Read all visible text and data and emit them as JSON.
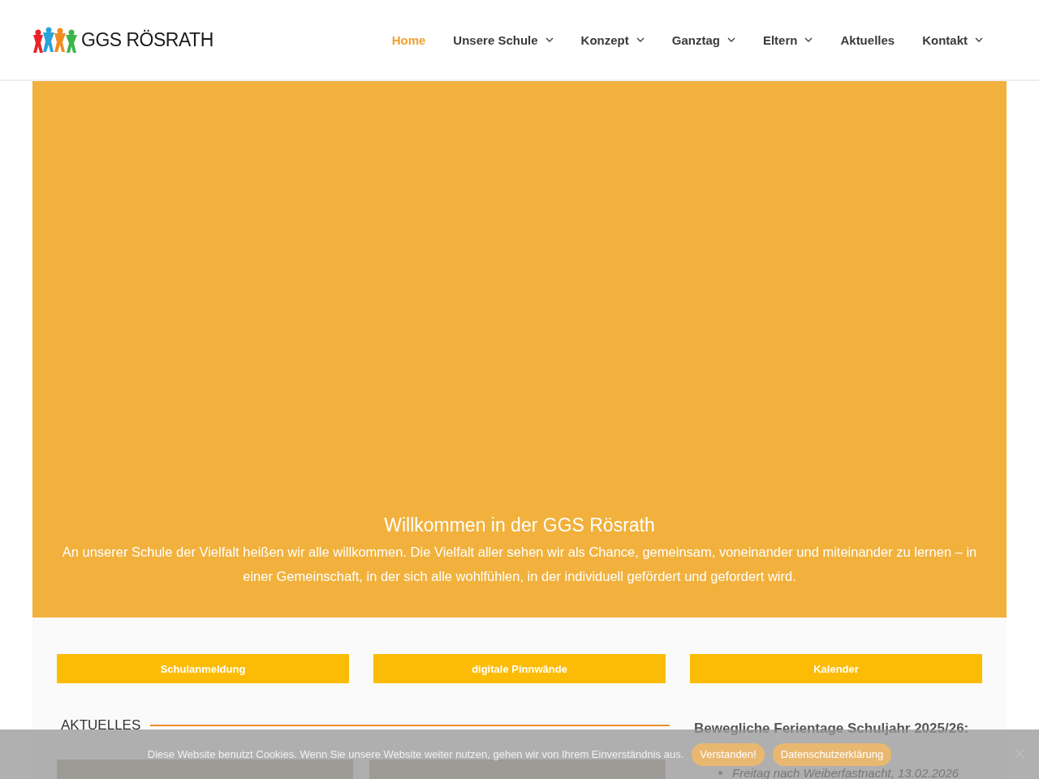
{
  "logo": {
    "text": "GGS RÖSRATH"
  },
  "nav": [
    {
      "label": "Home",
      "selected": true,
      "dropdown": false
    },
    {
      "label": "Unsere Schule",
      "selected": false,
      "dropdown": true
    },
    {
      "label": "Konzept",
      "selected": false,
      "dropdown": true
    },
    {
      "label": "Ganztag",
      "selected": false,
      "dropdown": true
    },
    {
      "label": "Eltern",
      "selected": false,
      "dropdown": true
    },
    {
      "label": "Aktuelles",
      "selected": false,
      "dropdown": false
    },
    {
      "label": "Kontakt",
      "selected": false,
      "dropdown": true
    }
  ],
  "hero": {
    "title": "Willkommen in der GGS Rösrath",
    "text": "An unserer Schule der Vielfalt heißen wir alle willkommen. Die Vielfalt aller sehen wir als Chance, gemeinsam, voneinander und miteinander zu lernen – in einer Gemeinschaft, in der sich alle wohlfühlen, in der individuell gefördert und gefordert wird."
  },
  "quick_links": [
    "Schulanmeldung",
    "digitale Pinnwände",
    "Kalender"
  ],
  "news": {
    "heading": "AKTUELLES",
    "posts": [
      {
        "kind": "photo"
      },
      {
        "kind": "photo"
      }
    ]
  },
  "sidebar": {
    "heading": "Bewegliche Ferientage Schuljahr 2025/26:",
    "items": [
      "Freitag nach Weiberfastnacht, 13.02.2026"
    ]
  },
  "cookie_banner": {
    "text": "Diese Website benutzt Cookies. Wenn Sie unsere Website weiter nutzen, gehen wir von Ihrem Einverständnis aus.",
    "buttons": [
      "Verstanden!",
      "Datenschutzerklärung"
    ]
  }
}
